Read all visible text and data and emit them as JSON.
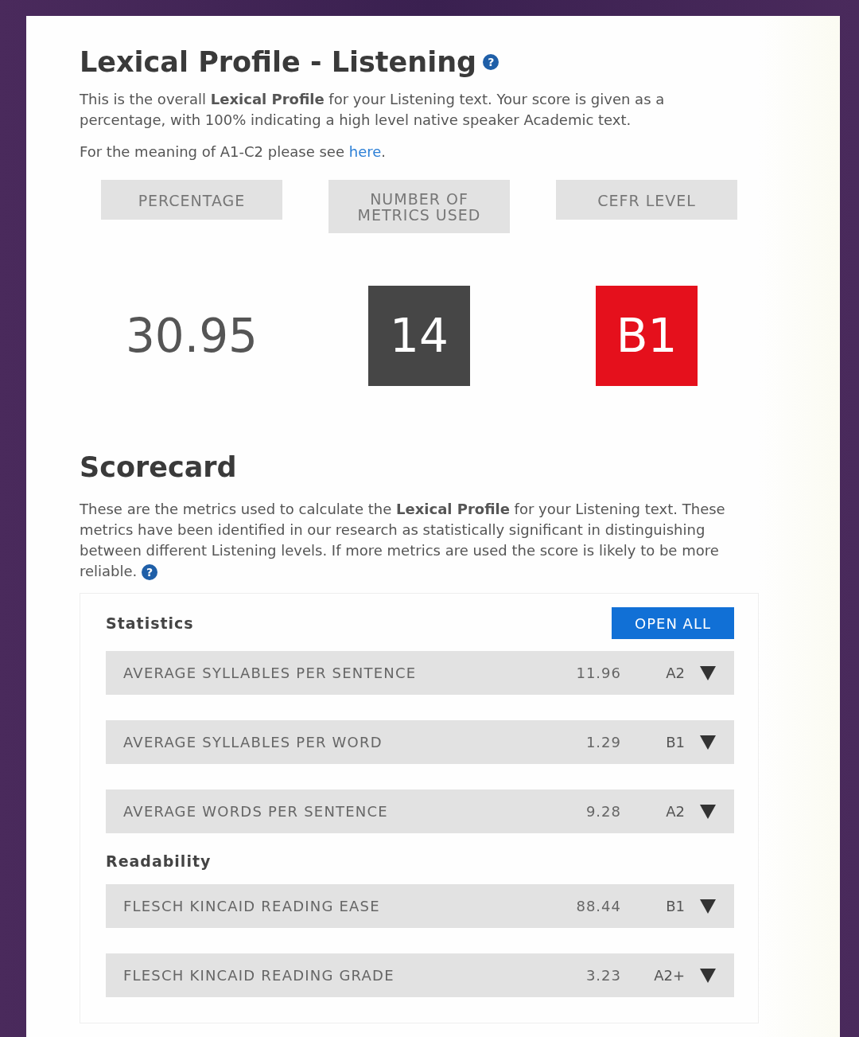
{
  "title": "Lexical Profile - Listening",
  "title_help": "?",
  "intro": "This is the overall **Lexical Profile** for your Listening text. Your score is given as a percentage, with 100% indicating a high level native speaker Academic text.",
  "meaning_note": {
    "before": "For the meaning of A1-C2 please see ",
    "link": "here",
    "after": "."
  },
  "summary": [
    {
      "heading": "PERCENTAGE",
      "value": "30.95",
      "kind": "plain"
    },
    {
      "heading": "NUMBER OF METRICS USED",
      "value": "14",
      "kind": "tile",
      "color": "#464646"
    },
    {
      "heading": "CEFR LEVEL",
      "value": "B1",
      "kind": "tile",
      "color": "#e5101c"
    }
  ],
  "scorecard": {
    "title": "Scorecard",
    "description": "These are the metrics used to calculate the **Lexical Profile** for your Listening text. These metrics have been identified in our research as statistically significant in distinguishing between different Listening levels. If more metrics are used the score is likely to be more reliable.",
    "help": "?",
    "open_all": "OPEN ALL",
    "groups": [
      {
        "name": "Statistics",
        "metrics": [
          {
            "name": "AVERAGE SYLLABLES PER SENTENCE",
            "value": "11.96",
            "level": "A2",
            "expanded": false
          },
          {
            "name": "AVERAGE SYLLABLES PER WORD",
            "value": "1.29",
            "level": "B1",
            "expanded": false
          },
          {
            "name": "AVERAGE WORDS PER SENTENCE",
            "value": "9.28",
            "level": "A2",
            "expanded": false
          }
        ]
      },
      {
        "name": "Readability",
        "metrics": [
          {
            "name": "FLESCH KINCAID READING EASE",
            "value": "88.44",
            "level": "B1",
            "expanded": false
          },
          {
            "name": "FLESCH KINCAID READING GRADE",
            "value": "3.23",
            "level": "A2+",
            "expanded": false
          }
        ]
      }
    ]
  }
}
